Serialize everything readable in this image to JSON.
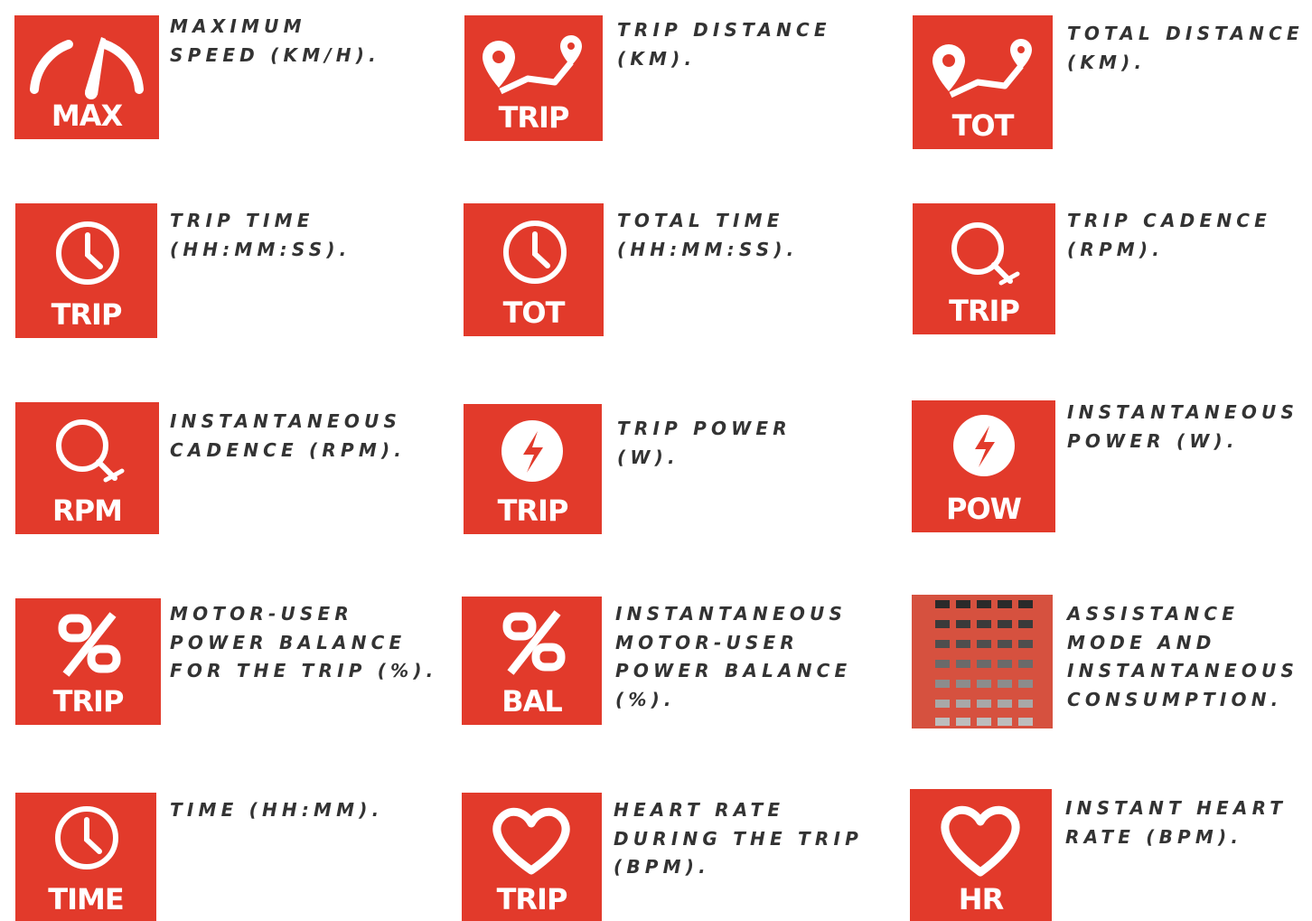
{
  "colors": {
    "icon_background": "#e23a2b",
    "icon_foreground": "#ffffff",
    "text": "#333333"
  },
  "items": [
    {
      "icon": "speedometer-icon",
      "label": "MAX",
      "description": "MAXIMUM\nSPEED (KM/H)."
    },
    {
      "icon": "route-icon",
      "label": "TRIP",
      "description": "TRIP DISTANCE\n(KM)."
    },
    {
      "icon": "route-icon",
      "label": "TOT",
      "description": "TOTAL DISTANCE\n(KM)."
    },
    {
      "icon": "clock-icon",
      "label": "TRIP",
      "description": "TRIP TIME\n(HH:MM:SS)."
    },
    {
      "icon": "clock-icon",
      "label": "TOT",
      "description": "TOTAL TIME\n(HH:MM:SS)."
    },
    {
      "icon": "cadence-icon",
      "label": "TRIP",
      "description": "TRIP CADENCE\n(RPM)."
    },
    {
      "icon": "cadence-icon",
      "label": "RPM",
      "description": "INSTANTANEOUS\nCADENCE (RPM)."
    },
    {
      "icon": "lightning-icon",
      "label": "TRIP",
      "description": "TRIP POWER\n(W)."
    },
    {
      "icon": "lightning-icon",
      "label": "POW",
      "description": "INSTANTANEOUS\nPOWER (W)."
    },
    {
      "icon": "percent-icon",
      "label": "TRIP",
      "description": "MOTOR-USER\nPOWER BALANCE\nFOR THE TRIP (%)."
    },
    {
      "icon": "percent-icon",
      "label": "BAL",
      "description": "INSTANTANEOUS\nMOTOR-USER\nPOWER BALANCE\n(%)."
    },
    {
      "icon": "assistance-bars-icon",
      "label": "",
      "description": "ASSISTANCE\nMODE AND\nINSTANTANEOUS\nCONSUMPTION."
    },
    {
      "icon": "clock-icon",
      "label": "TIME",
      "description": "TIME (HH:MM)."
    },
    {
      "icon": "heart-icon",
      "label": "TRIP",
      "description": "HEART RATE\nDURING THE TRIP\n(BPM)."
    },
    {
      "icon": "heart-icon",
      "label": "HR",
      "description": "INSTANT HEART\nRATE (BPM)."
    }
  ]
}
